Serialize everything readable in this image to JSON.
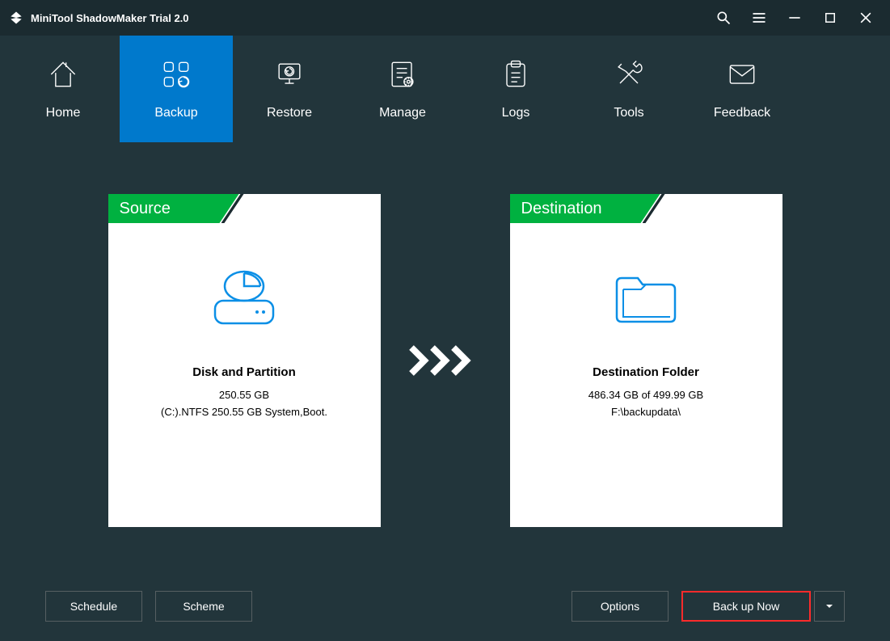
{
  "titlebar": {
    "title": "MiniTool ShadowMaker Trial 2.0"
  },
  "nav": {
    "items": [
      {
        "label": "Home"
      },
      {
        "label": "Backup"
      },
      {
        "label": "Restore"
      },
      {
        "label": "Manage"
      },
      {
        "label": "Logs"
      },
      {
        "label": "Tools"
      },
      {
        "label": "Feedback"
      }
    ],
    "activeIndex": 1
  },
  "source": {
    "header": "Source",
    "title": "Disk and Partition",
    "size": "250.55 GB",
    "detail": "(C:).NTFS 250.55 GB System,Boot."
  },
  "destination": {
    "header": "Destination",
    "title": "Destination Folder",
    "size": "486.34 GB of 499.99 GB",
    "path": "F:\\backupdata\\"
  },
  "buttons": {
    "schedule": "Schedule",
    "scheme": "Scheme",
    "options": "Options",
    "backupNow": "Back up Now"
  }
}
